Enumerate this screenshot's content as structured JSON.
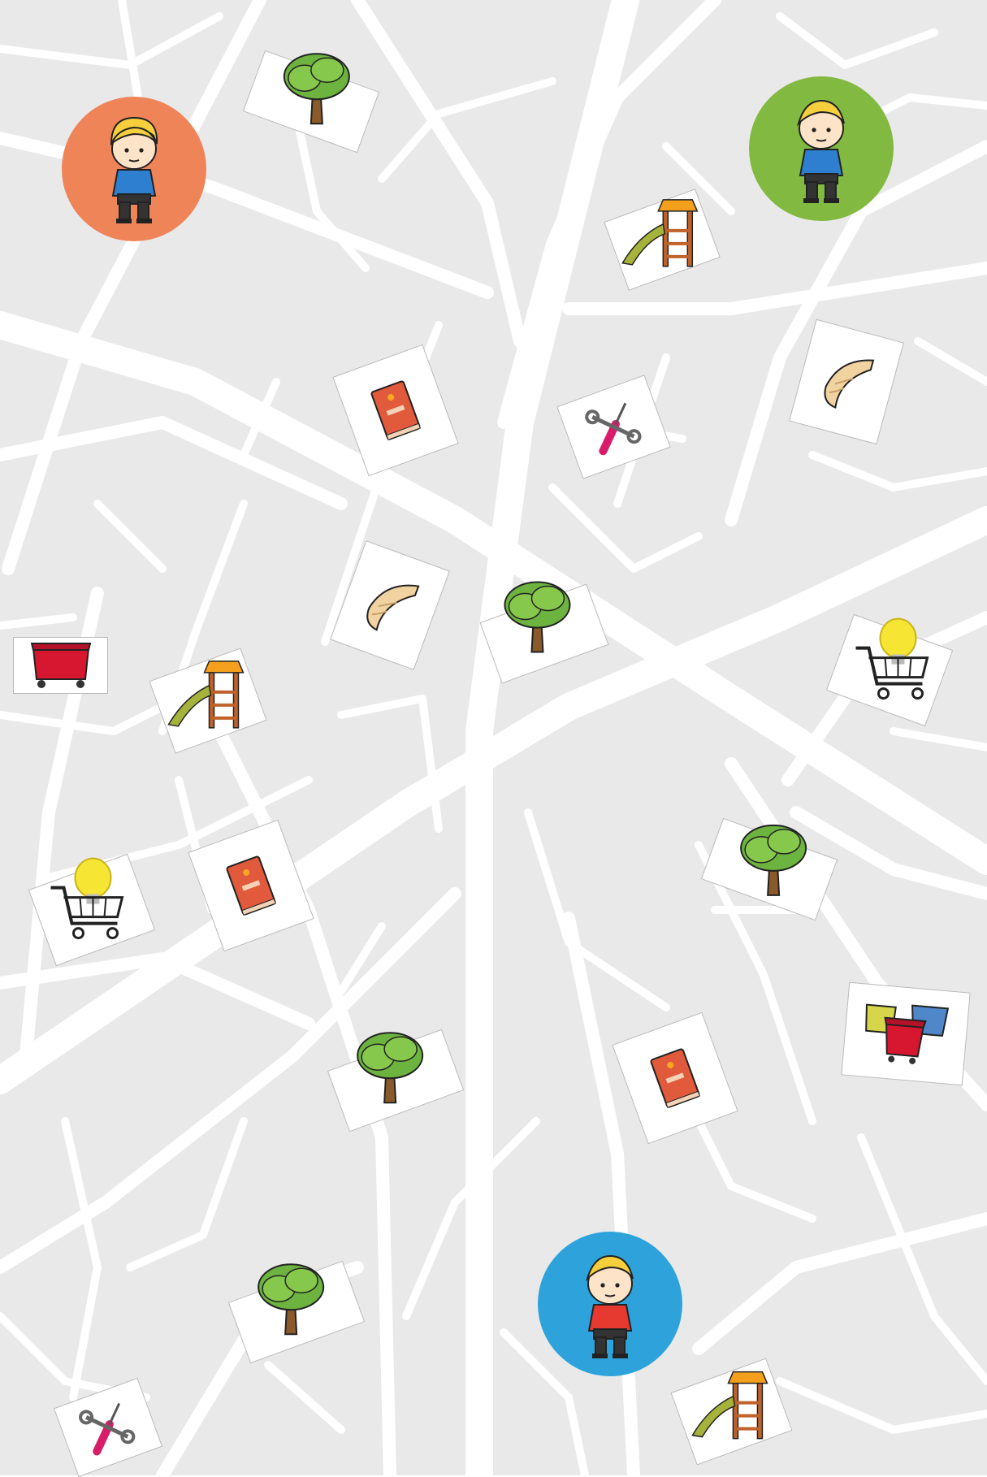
{
  "board": {
    "background_color": "#e9e9ea",
    "road_color": "#ffffff"
  },
  "players": [
    {
      "color": "#ef8459",
      "shirt": "#2f7fd0",
      "icon": "boy-icon"
    },
    {
      "color": "#82b941",
      "shirt": "#2f7fd0",
      "icon": "boy-icon"
    },
    {
      "color": "#2ea3db",
      "shirt": "#e6392f",
      "icon": "boy-icon"
    }
  ],
  "locations": [
    {
      "type": "tree",
      "icon": "tree-icon"
    },
    {
      "type": "playground",
      "icon": "playground-slide-icon"
    },
    {
      "type": "library",
      "icon": "book-icon"
    },
    {
      "type": "hardware-store",
      "icon": "screwdriver-wrench-icon"
    },
    {
      "type": "bakery",
      "icon": "croissant-icon"
    },
    {
      "type": "tree",
      "icon": "tree-icon"
    },
    {
      "type": "bakery",
      "icon": "croissant-icon"
    },
    {
      "type": "recycling",
      "icon": "red-container-icon"
    },
    {
      "type": "playground",
      "icon": "playground-slide-icon"
    },
    {
      "type": "supermarket",
      "icon": "shopping-cart-bulb-icon"
    },
    {
      "type": "supermarket",
      "icon": "shopping-cart-bulb-icon"
    },
    {
      "type": "library",
      "icon": "book-icon"
    },
    {
      "type": "tree",
      "icon": "tree-icon"
    },
    {
      "type": "tree",
      "icon": "tree-icon"
    },
    {
      "type": "library",
      "icon": "book-icon"
    },
    {
      "type": "recycling",
      "icon": "recycling-bins-icon"
    },
    {
      "type": "tree",
      "icon": "tree-icon"
    },
    {
      "type": "playground",
      "icon": "playground-slide-icon"
    },
    {
      "type": "hardware-store",
      "icon": "screwdriver-wrench-icon"
    }
  ]
}
